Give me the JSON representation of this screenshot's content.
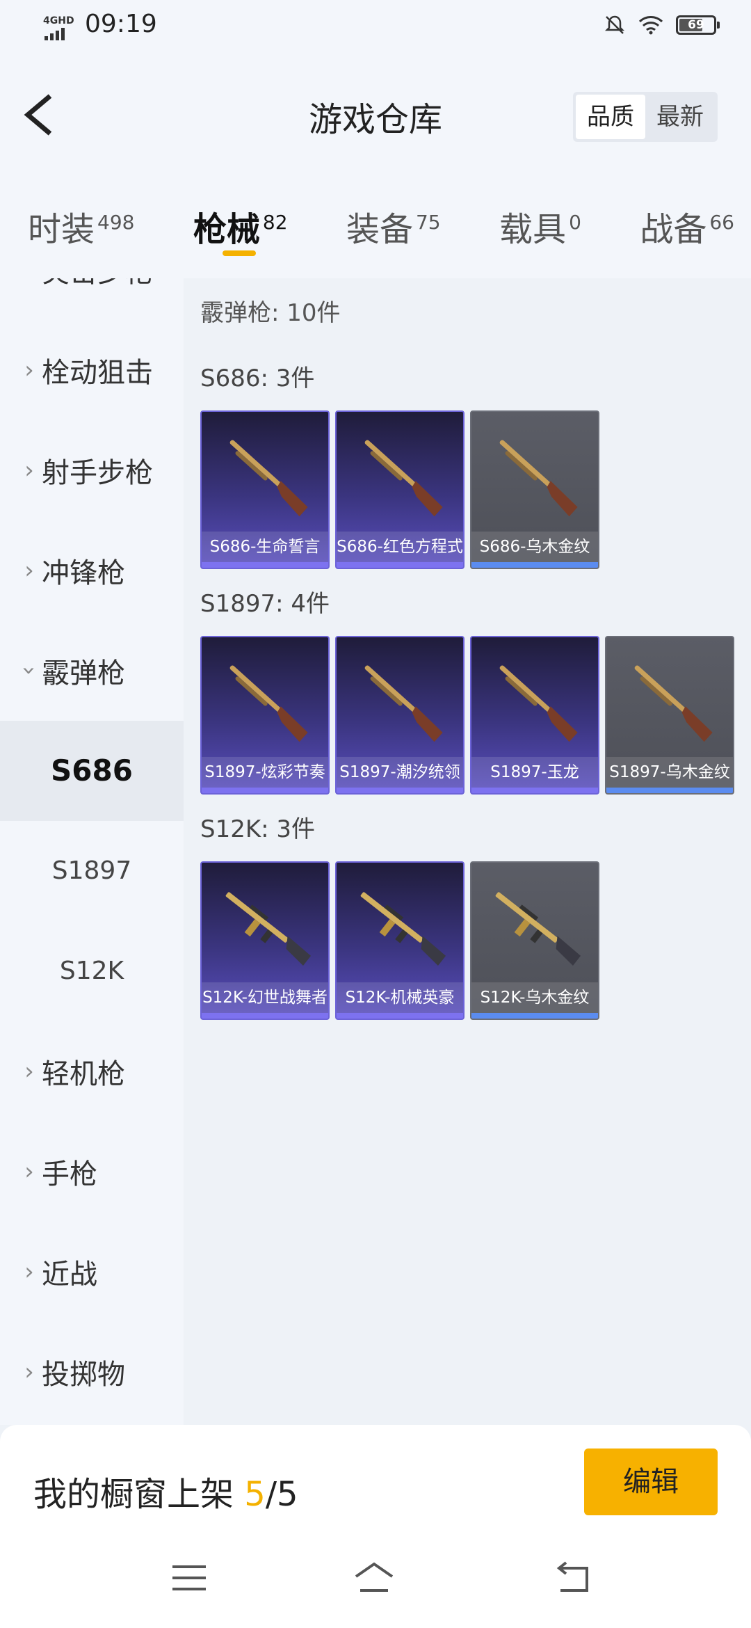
{
  "status": {
    "network": "4GHD",
    "time": "09:19",
    "battery": "69",
    "battery_level": 0.69
  },
  "header": {
    "title": "游戏仓库",
    "sort_quality": "品质",
    "sort_latest": "最新"
  },
  "tabs": [
    {
      "label": "时装",
      "count": "498"
    },
    {
      "label": "枪械",
      "count": "82"
    },
    {
      "label": "装备",
      "count": "75"
    },
    {
      "label": "载具",
      "count": "0"
    },
    {
      "label": "战备",
      "count": "66"
    }
  ],
  "sidebar": {
    "partial_top": "突击步枪",
    "items": [
      "栓动狙击",
      "射手步枪",
      "冲锋枪",
      "霰弹枪"
    ],
    "subs": [
      "S686",
      "S1897",
      "S12K"
    ],
    "items_after": [
      "轻机枪",
      "手枪",
      "近战",
      "投掷物"
    ]
  },
  "main": {
    "category_count": "霰弹枪: 10件",
    "groups": [
      {
        "label": "S686: 3件",
        "cards": [
          {
            "name": "S686-生命誓言",
            "rarity": "purple"
          },
          {
            "name": "S686-红色方程式",
            "rarity": "purple"
          },
          {
            "name": "S686-乌木金纹",
            "rarity": "gray"
          }
        ]
      },
      {
        "label": "S1897: 4件",
        "cards": [
          {
            "name": "S1897-炫彩节奏",
            "rarity": "purple"
          },
          {
            "name": "S1897-潮汐统领",
            "rarity": "purple"
          },
          {
            "name": "S1897-玉龙",
            "rarity": "purple"
          },
          {
            "name": "S1897-乌木金纹",
            "rarity": "gray"
          }
        ]
      },
      {
        "label": "S12K: 3件",
        "cards": [
          {
            "name": "S12K-幻世战舞者",
            "rarity": "purple"
          },
          {
            "name": "S12K-机械英豪",
            "rarity": "purple"
          },
          {
            "name": "S12K-乌木金纹",
            "rarity": "gray"
          }
        ]
      }
    ]
  },
  "showcase": {
    "label": "我的橱窗上架 ",
    "current": "5",
    "sep_total": "/5",
    "edit": "编辑"
  },
  "colors": {
    "accent": "#f4b100",
    "purple": "#5a4fbf",
    "gray": "#5b5d66"
  }
}
